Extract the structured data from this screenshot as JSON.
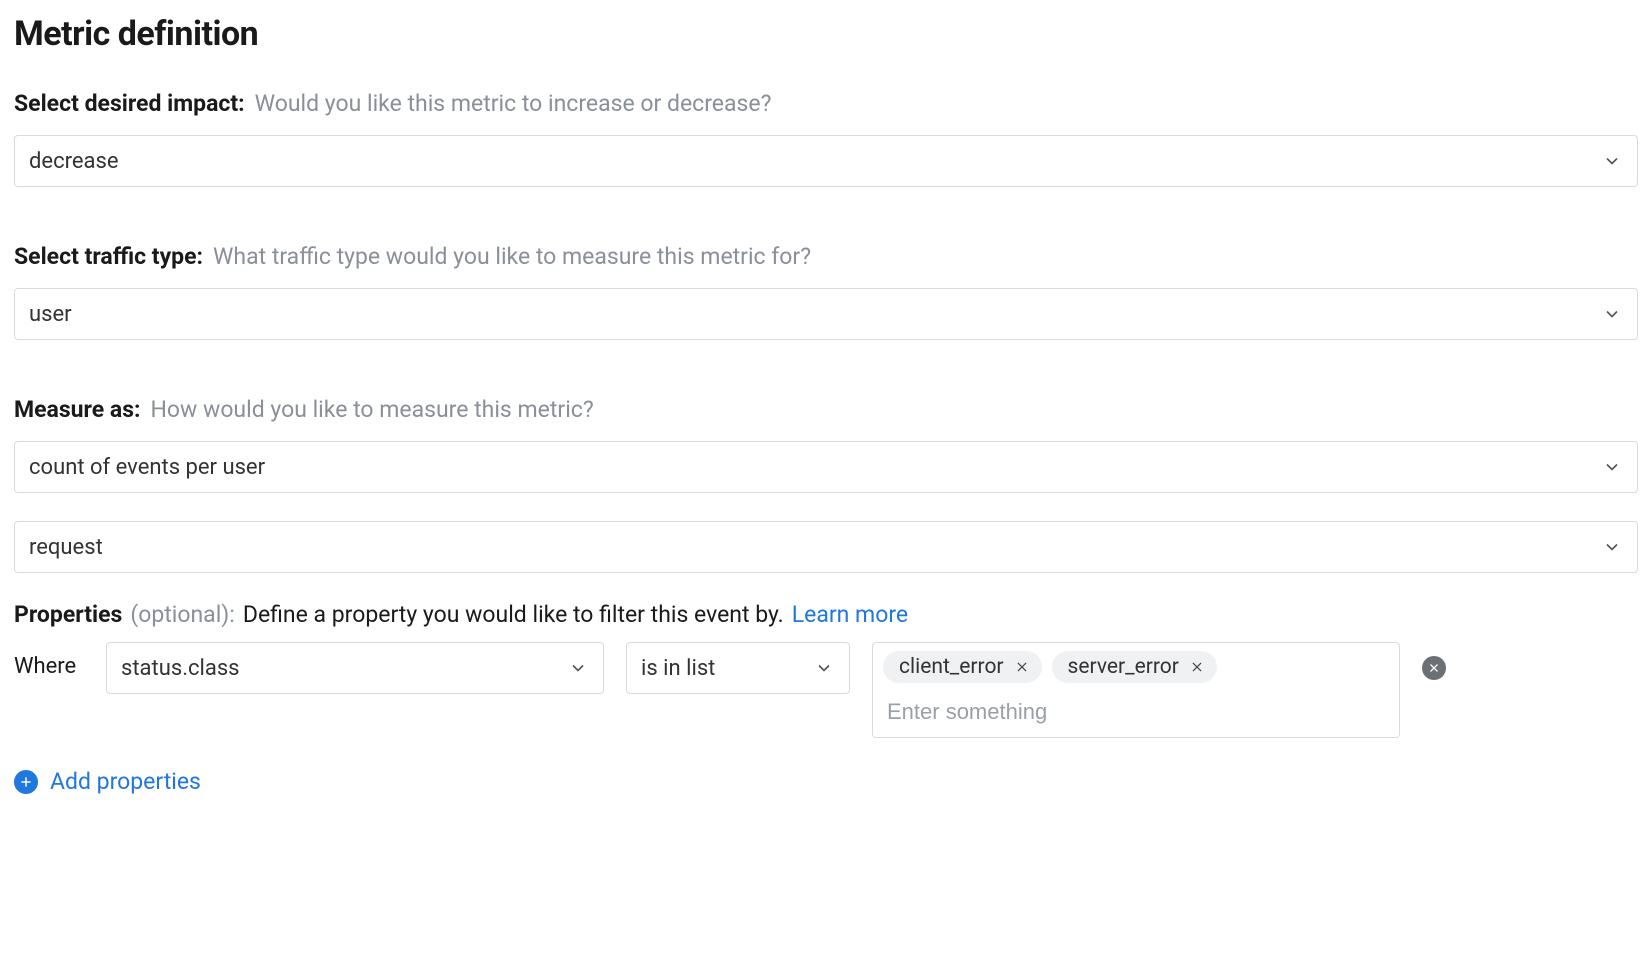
{
  "title": "Metric definition",
  "impact": {
    "label": "Select desired impact:",
    "hint": "Would you like this metric to increase or decrease?",
    "value": "decrease"
  },
  "traffic": {
    "label": "Select traffic type:",
    "hint": "What traffic type would you like to measure this metric for?",
    "value": "user"
  },
  "measure": {
    "label": "Measure as:",
    "hint": "How would you like to measure this metric?",
    "value": "count of events per user",
    "event_value": "request"
  },
  "properties": {
    "label": "Properties",
    "optional": "(optional):",
    "hint": "Define a property you would like to filter this event by.",
    "learn_more": "Learn more",
    "where": "Where",
    "filter": {
      "property": "status.class",
      "operator": "is in list",
      "values": [
        "client_error",
        "server_error"
      ],
      "placeholder": "Enter something"
    },
    "add_label": "Add properties"
  }
}
